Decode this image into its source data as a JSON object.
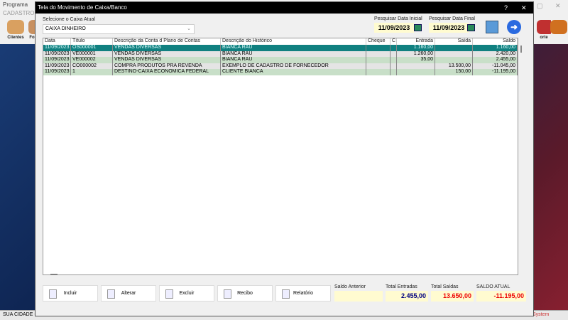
{
  "app": {
    "title": "Programa",
    "menu": "CADASTROS",
    "tools": [
      {
        "label": "Clientes"
      },
      {
        "label": "Fo"
      }
    ],
    "right_tool": "orte",
    "status_left": "SUA CIDADE -",
    "status_right": "System"
  },
  "dialog": {
    "title": "Tela do Movimento de Caixa/Banco",
    "help": "?",
    "close": "✕",
    "caixa_label": "Selecione o Caixa Atual",
    "caixa_value": "CAIXA DINHEIRO",
    "date_start_label": "Pesquisar Data Inicial",
    "date_start": "11/09/2023",
    "date_end_label": "Pesquisar Data Final",
    "date_end": "11/09/2023"
  },
  "grid": {
    "columns": [
      "Data",
      "Título",
      "Descrição da Conta d Plano de Contas",
      "Descrição do Histórico",
      "Cheque",
      "C",
      "Entrada",
      "Saída",
      "Saldo"
    ],
    "rows": [
      [
        "11/09/2023",
        "OS000001",
        "VENDAS DIVERSAS",
        "BIANCA RAU",
        "",
        "",
        "1.160,00",
        "",
        "1.160,00"
      ],
      [
        "11/09/2023",
        "VE000001",
        "VENDAS DIVERSAS",
        "BIANCA RAU",
        "",
        "",
        "1.260,00",
        "",
        "2.420,00"
      ],
      [
        "11/09/2023",
        "VE000002",
        "VENDAS DIVERSAS",
        "BIANCA RAU",
        "",
        "",
        "35,00",
        "",
        "2.455,00"
      ],
      [
        "11/09/2023",
        "CO000002",
        "COMPRA PRODUTOS PRA REVENDA",
        "EXEMPLO DE CADASTRO DE FORNECEDOR",
        "",
        "",
        "",
        "13.500,00",
        "-11.045,00"
      ],
      [
        "11/09/2023",
        "1",
        "DESTINO-CAIXA ECONOMICA FEDERAL",
        "CLIENTE BIANCA",
        "",
        "",
        "",
        "150,00",
        "-11.195,00"
      ]
    ]
  },
  "buttons": [
    "Incluir",
    "Alterar",
    "Excluir",
    "Recibo",
    "Relatório"
  ],
  "totals": {
    "saldo_anterior_label": "Saldo Anterior",
    "saldo_anterior": "",
    "entradas_label": "Total Entradas",
    "entradas": "2.455,00",
    "saidas_label": "Total Saídas",
    "saidas": "13.650,00",
    "atual_label": "SALDO ATUAL",
    "atual": "-11.195,00"
  },
  "colors": {
    "selected": "#108080",
    "green_row": "#c8dfc8",
    "gray_row": "#e4e4e4"
  }
}
